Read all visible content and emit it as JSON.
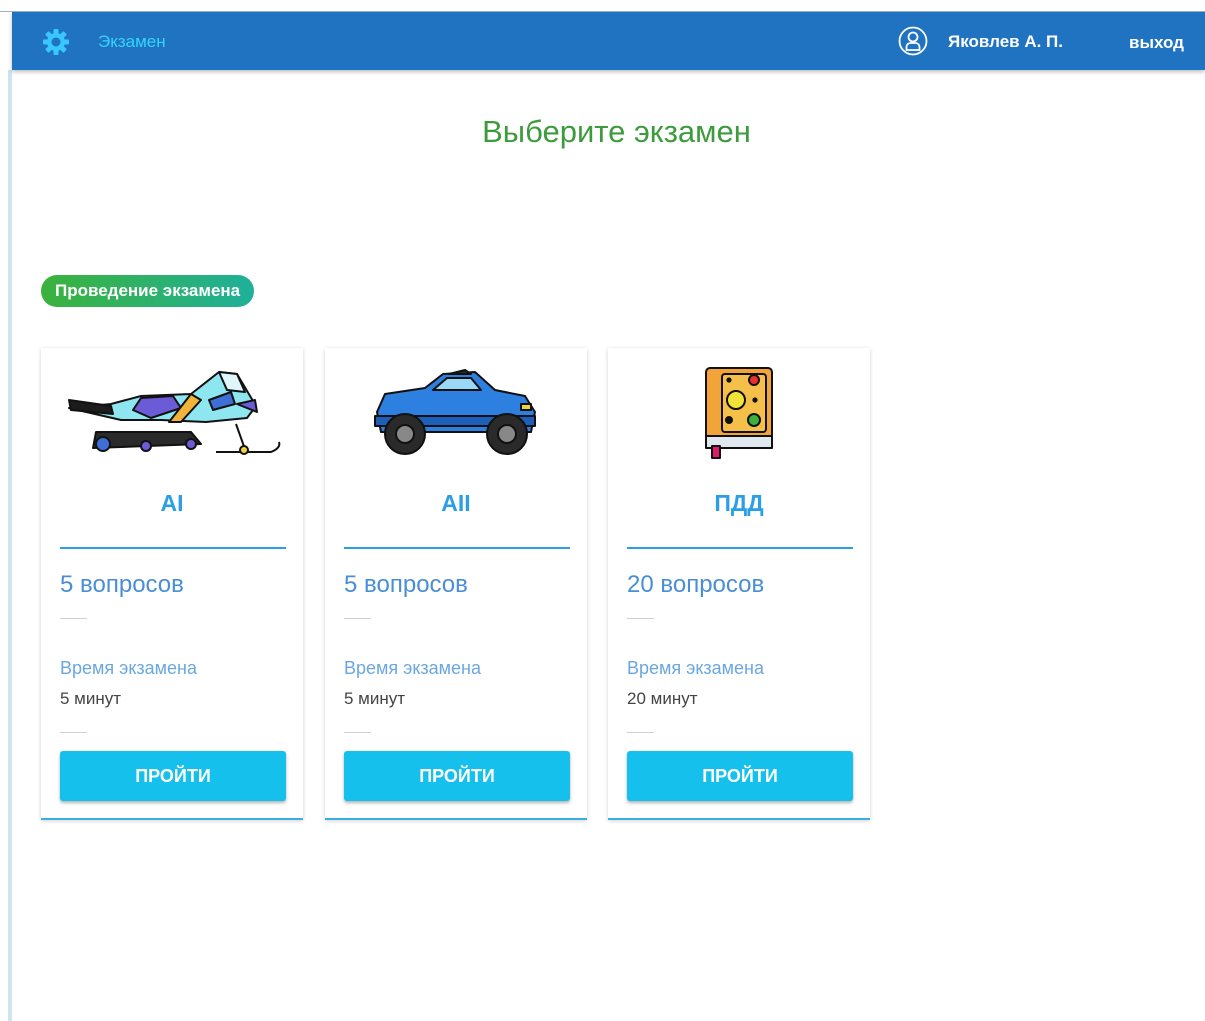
{
  "header": {
    "app_title": "Экзамен",
    "user_name": "Яковлев А. П.",
    "logout_label": "выход"
  },
  "page": {
    "title": "Выберите экзамен",
    "badge": "Проведение экзамена"
  },
  "exams": [
    {
      "title": "AI",
      "questions": "5 вопросов",
      "time_label": "Время экзамена",
      "time_value": "5 минут",
      "button": "ПРОЙТИ",
      "icon": "snowmobile-icon"
    },
    {
      "title": "AII",
      "questions": "5 вопросов",
      "time_label": "Время экзамена",
      "time_value": "5 минут",
      "button": "ПРОЙТИ",
      "icon": "car-icon"
    },
    {
      "title": "ПДД",
      "questions": "20 вопросов",
      "time_label": "Время экзамена",
      "time_value": "20 минут",
      "button": "ПРОЙТИ",
      "icon": "traffic-book-icon"
    }
  ],
  "colors": {
    "header_bg": "#1f73c0",
    "accent": "#2b9fe6",
    "button": "#16c0ec",
    "title_green": "#3d9a3d"
  }
}
